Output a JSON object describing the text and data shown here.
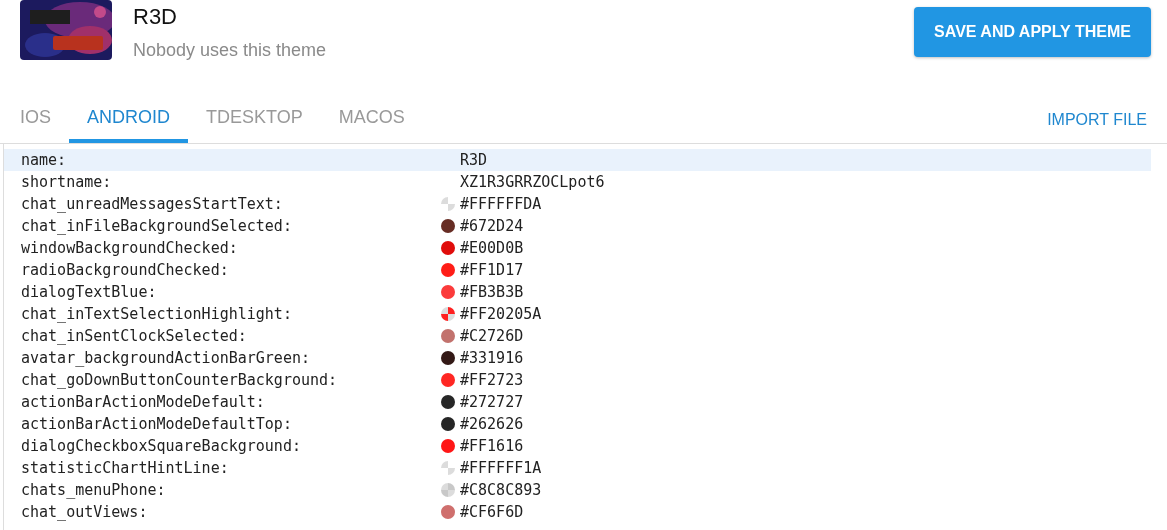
{
  "theme": {
    "title": "R3D",
    "subtitle": "Nobody uses this theme",
    "save_button": "SAVE AND APPLY THEME"
  },
  "tabs": [
    {
      "label": "IOS",
      "selected": false
    },
    {
      "label": "ANDROID",
      "selected": true
    },
    {
      "label": "TDESKTOP",
      "selected": false
    },
    {
      "label": "MACOS",
      "selected": false
    }
  ],
  "import_button": "IMPORT FILE",
  "properties": [
    {
      "key": "name:",
      "value": "R3D",
      "selected": true
    },
    {
      "key": "shortname:",
      "value": "XZ1R3GRRZOCLpot6",
      "selected": false
    },
    {
      "key": "chat_unreadMessagesStartText:",
      "value": "#FFFFFFDA",
      "color": "#ffffff",
      "translucent": true,
      "selected": false
    },
    {
      "key": "chat_inFileBackgroundSelected:",
      "value": "#672D24",
      "color": "#672d24",
      "translucent": false,
      "selected": false
    },
    {
      "key": "windowBackgroundChecked:",
      "value": "#E00D0B",
      "color": "#e00d0b",
      "translucent": false,
      "selected": false
    },
    {
      "key": "radioBackgroundChecked:",
      "value": "#FF1D17",
      "color": "#ff1d17",
      "translucent": false,
      "selected": false
    },
    {
      "key": "dialogTextBlue:",
      "value": "#FB3B3B",
      "color": "#fb3b3b",
      "translucent": false,
      "selected": false
    },
    {
      "key": "chat_inTextSelectionHighlight:",
      "value": "#FF20205A",
      "color": "#ff2020",
      "translucent": true,
      "selected": false
    },
    {
      "key": "chat_inSentClockSelected:",
      "value": "#C2726D",
      "color": "#c2726d",
      "translucent": false,
      "selected": false
    },
    {
      "key": "avatar_backgroundActionBarGreen:",
      "value": "#331916",
      "color": "#331916",
      "translucent": false,
      "selected": false
    },
    {
      "key": "chat_goDownButtonCounterBackground:",
      "value": "#FF2723",
      "color": "#ff2723",
      "translucent": false,
      "selected": false
    },
    {
      "key": "actionBarActionModeDefault:",
      "value": "#272727",
      "color": "#272727",
      "translucent": false,
      "selected": false
    },
    {
      "key": "actionBarActionModeDefaultTop:",
      "value": "#262626",
      "color": "#262626",
      "translucent": false,
      "selected": false
    },
    {
      "key": "dialogCheckboxSquareBackground:",
      "value": "#FF1616",
      "color": "#ff1616",
      "translucent": false,
      "selected": false
    },
    {
      "key": "statisticChartHintLine:",
      "value": "#FFFFFF1A",
      "color": "#ffffff",
      "translucent": true,
      "selected": false
    },
    {
      "key": "chats_menuPhone:",
      "value": "#C8C8C893",
      "color": "#c8c8c8",
      "translucent": true,
      "selected": false
    },
    {
      "key": "chat_outViews:",
      "value": "#CF6F6D",
      "color": "#cf6f6d",
      "translucent": false,
      "selected": false
    }
  ]
}
